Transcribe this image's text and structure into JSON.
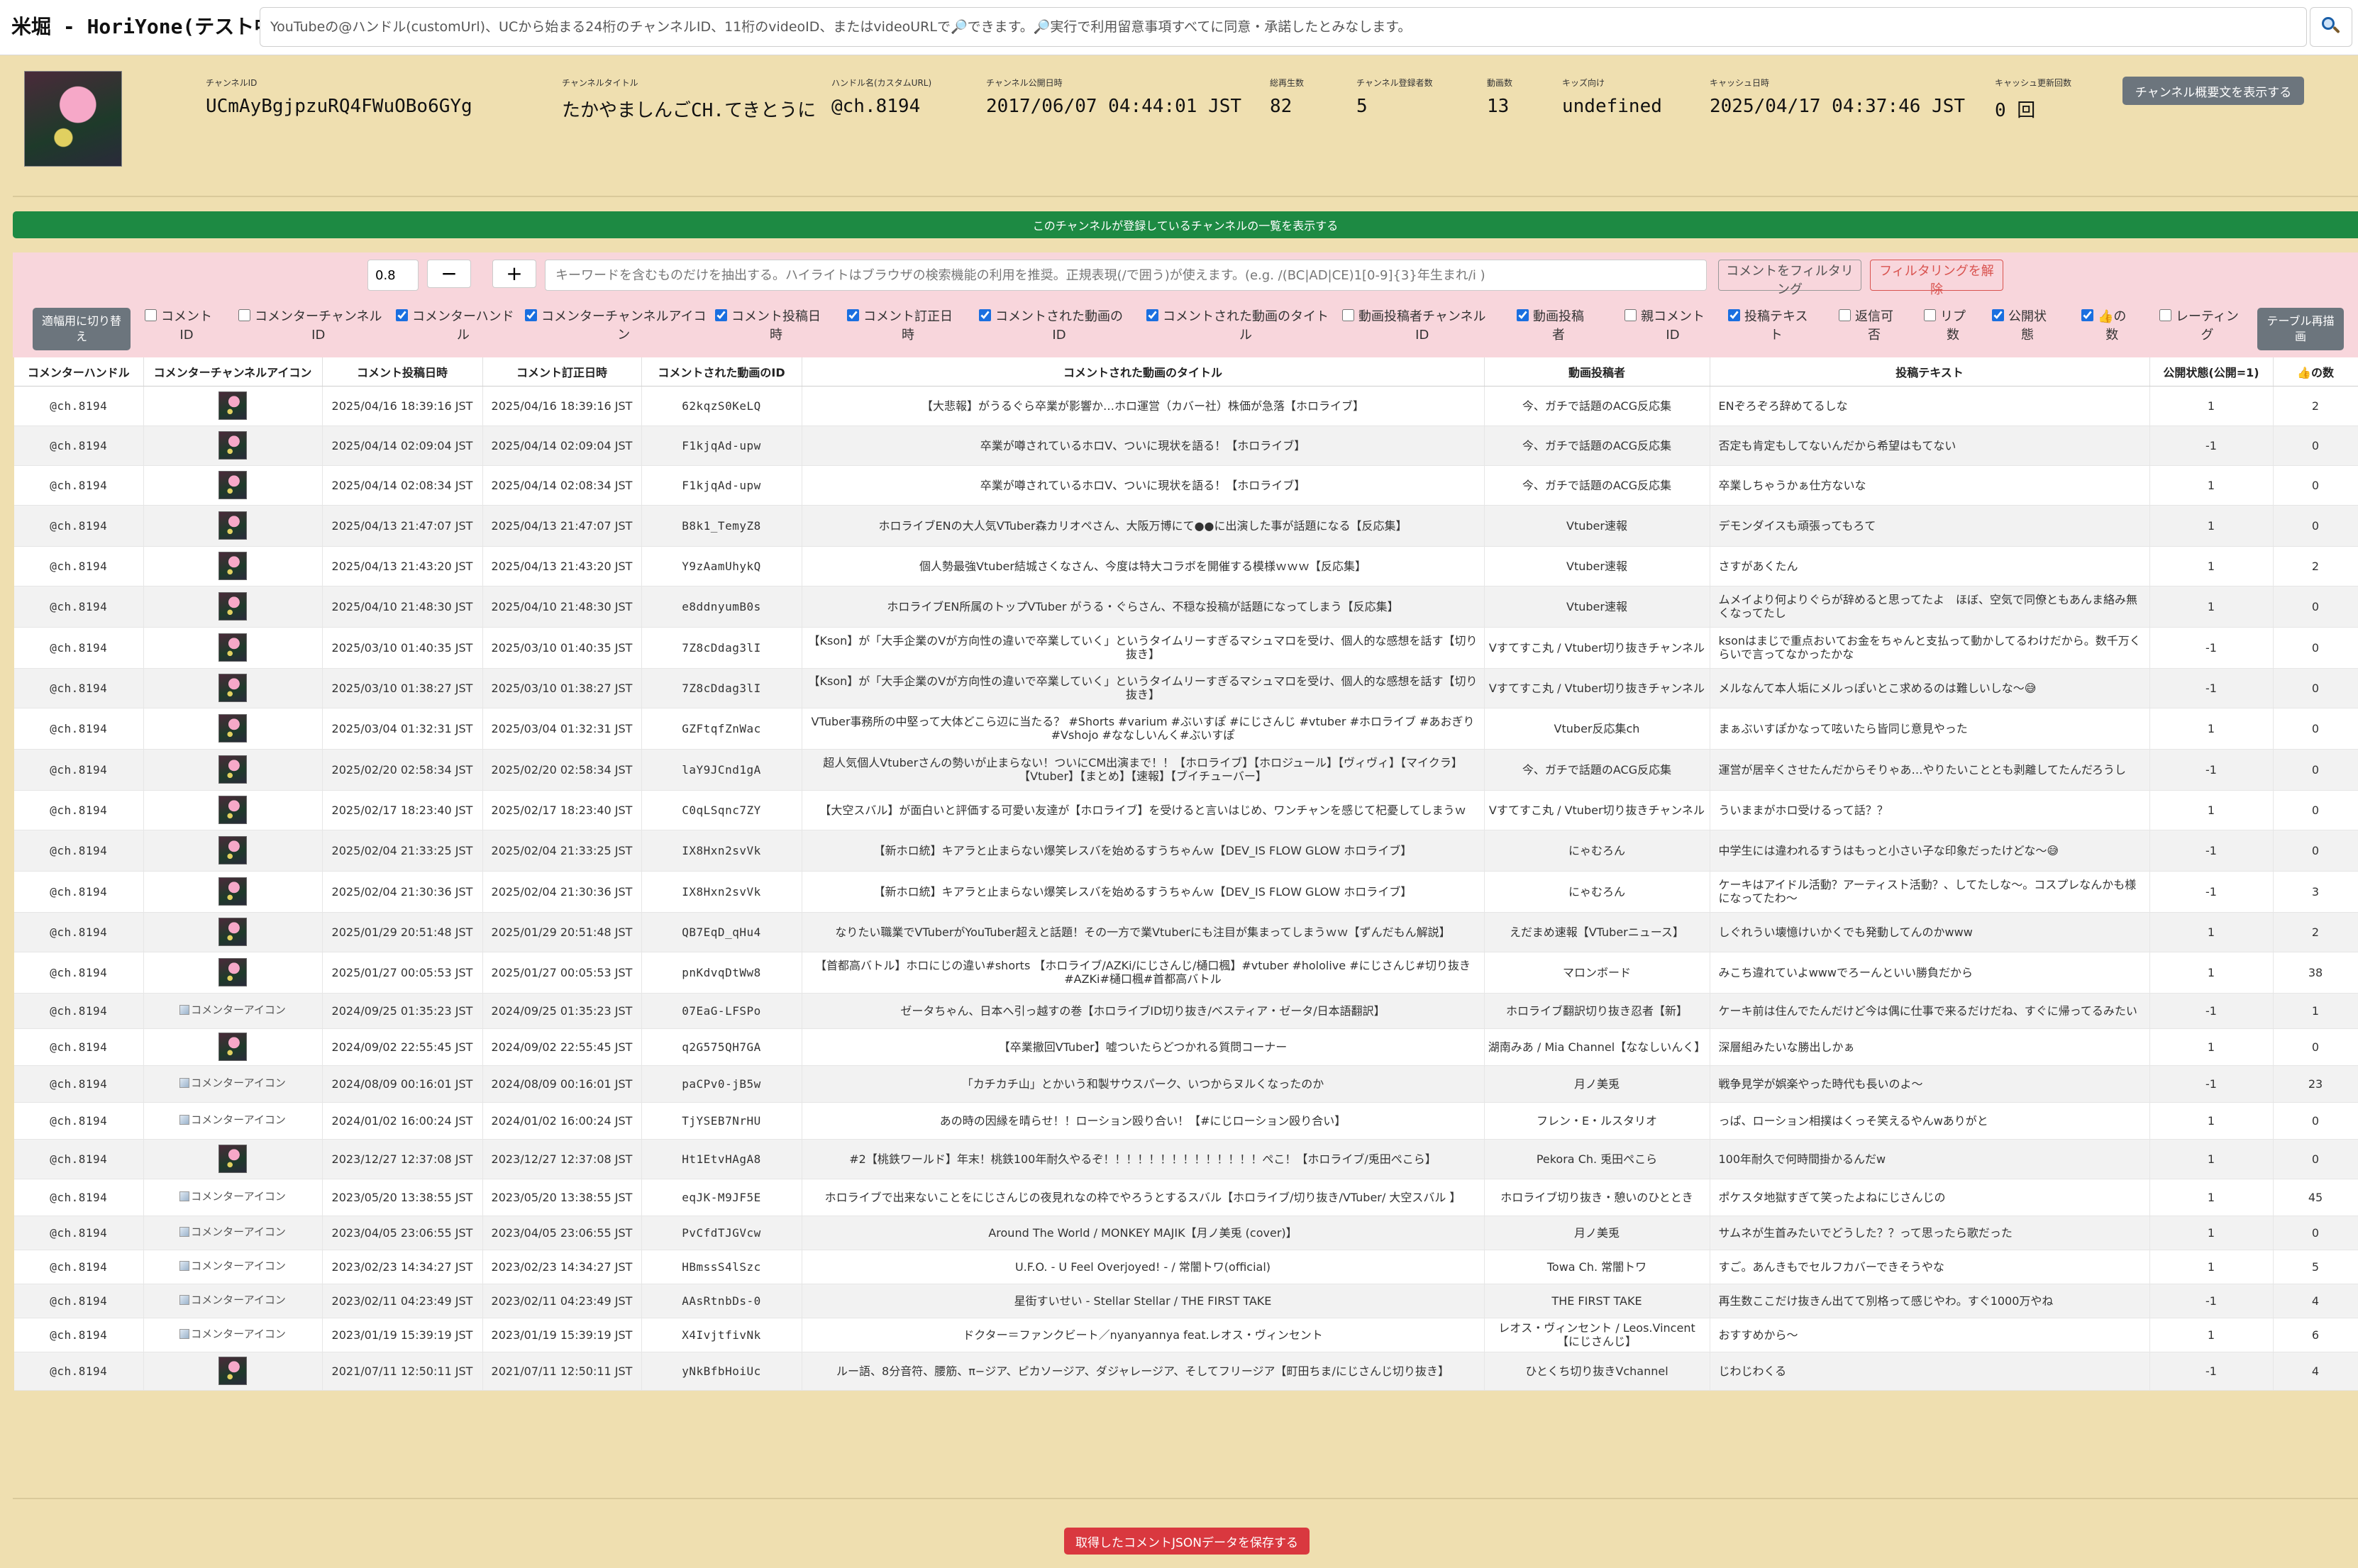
{
  "app": {
    "title": "米堀 - HoriYone(テスト中)"
  },
  "search": {
    "placeholder": "YouTubeの@ハンドル(customUrl)、UCから始まる24桁のチャンネルID、11桁のvideoID、またはvideoURLで🔎できます。🔎実行で利用留意事項すべてに同意・承諾したとみなします。",
    "button_icon": "magnifier-icon"
  },
  "channel": {
    "fields": [
      {
        "label": "チャンネルID",
        "value": "UCmAyBgjpzuRQ4FWuOBo6GYg"
      },
      {
        "label": "チャンネルタイトル",
        "value": "たかやましんごCH.てきとうに"
      },
      {
        "label": "ハンドル名(カスタムURL)",
        "value": "@ch.8194"
      },
      {
        "label": "チャンネル公開日時",
        "value": "2017/06/07 04:44:01 JST"
      },
      {
        "label": "総再生数",
        "value": "82"
      },
      {
        "label": "チャンネル登録者数",
        "value": "5"
      },
      {
        "label": "動画数",
        "value": "13"
      },
      {
        "label": "キッズ向け",
        "value": "undefined"
      },
      {
        "label": "キャッシュ日時",
        "value": "2025/04/17 04:37:46 JST"
      },
      {
        "label": "キャッシュ更新回数",
        "value": "0 回"
      }
    ],
    "show_description_label": "チャンネル概要文を表示する"
  },
  "subscriptions_button_label": "このチャンネルが登録しているチャンネルの一覧を表示する",
  "filter": {
    "number_value": "0.8",
    "minus_label": "−",
    "plus_label": "+",
    "keyword_placeholder": "キーワードを含むものだけを抽出する。ハイライトはブラウザの検索機能の利用を推奨。正規表現(/で囲う)が使えます。(e.g. /(BC|AD|CE)1[0-9]{3}年生まれ/i )",
    "filter_button": "コメントをフィルタリング",
    "unfilter_button": "フィルタリングを解除",
    "width_toggle": [
      "適幅用に切り替",
      "え"
    ],
    "redraw": [
      "テーブル再描",
      "画"
    ],
    "checkboxes": [
      {
        "lines": [
          "コメント",
          "ID"
        ],
        "checked": false
      },
      {
        "lines": [
          "コメンターチャンネル",
          "ID"
        ],
        "checked": false
      },
      {
        "lines": [
          "コメンターハンド",
          "ル"
        ],
        "checked": true
      },
      {
        "lines": [
          "コメンターチャンネルアイコ",
          "ン"
        ],
        "checked": true
      },
      {
        "lines": [
          "コメント投稿日",
          "時"
        ],
        "checked": true
      },
      {
        "lines": [
          "コメント訂正日",
          "時"
        ],
        "checked": true
      },
      {
        "lines": [
          "コメントされた動画の",
          "ID"
        ],
        "checked": true
      },
      {
        "lines": [
          "コメントされた動画のタイト",
          "ル"
        ],
        "checked": true
      },
      {
        "lines": [
          "動画投稿者チャンネル",
          "ID"
        ],
        "checked": false
      },
      {
        "lines": [
          "動画投稿",
          "者"
        ],
        "checked": true
      },
      {
        "lines": [
          "親コメント",
          "ID"
        ],
        "checked": false
      },
      {
        "lines": [
          "投稿テキス",
          "ト"
        ],
        "checked": true
      },
      {
        "lines": [
          "返信可",
          "否"
        ],
        "checked": false
      },
      {
        "lines": [
          "リプ",
          "数"
        ],
        "checked": false
      },
      {
        "lines": [
          "公開状",
          "態"
        ],
        "checked": true
      },
      {
        "lines": [
          "👍の",
          "数"
        ],
        "checked": true
      },
      {
        "lines": [
          "レーティン",
          "グ"
        ],
        "checked": false
      }
    ]
  },
  "table": {
    "headers": [
      "コメンターハンドル",
      "コメンターチャンネルアイコン",
      "コメント投稿日時",
      "コメント訂正日時",
      "コメントされた動画のID",
      "コメントされた動画のタイトル",
      "動画投稿者",
      "投稿テキスト",
      "公開状態(公開=1)",
      "👍の数"
    ],
    "rows": [
      {
        "handle": "@ch.8194",
        "icon": "avatar",
        "posted": "2025/04/16 18:39:16 JST",
        "edited": "2025/04/16 18:39:16 JST",
        "video_id": "62kqzS0KeLQ",
        "video_title": "【大悲報】がうるぐら卒業が影響か…ホロ運営（カバー社）株価が急落【ホロライブ】",
        "uploader": "今、ガチで話題のACG反応集",
        "text": "ENぞろぞろ辞めてるしな",
        "public": "1",
        "likes": "2"
      },
      {
        "handle": "@ch.8194",
        "icon": "avatar",
        "posted": "2025/04/14 02:09:04 JST",
        "edited": "2025/04/14 02:09:04 JST",
        "video_id": "F1kjqAd-upw",
        "video_title": "卒業が噂されているホロV、ついに現状を語る！【ホロライブ】",
        "uploader": "今、ガチで話題のACG反応集",
        "text": "否定も肯定もしてないんだから希望はもてない",
        "public": "-1",
        "likes": "0"
      },
      {
        "handle": "@ch.8194",
        "icon": "avatar",
        "posted": "2025/04/14 02:08:34 JST",
        "edited": "2025/04/14 02:08:34 JST",
        "video_id": "F1kjqAd-upw",
        "video_title": "卒業が噂されているホロV、ついに現状を語る！【ホロライブ】",
        "uploader": "今、ガチで話題のACG反応集",
        "text": "卒業しちゃうかぁ仕方ないな",
        "public": "1",
        "likes": "0"
      },
      {
        "handle": "@ch.8194",
        "icon": "avatar",
        "posted": "2025/04/13 21:47:07 JST",
        "edited": "2025/04/13 21:47:07 JST",
        "video_id": "B8k1_TemyZ8",
        "video_title": "ホロライブENの大人気VTuber森カリオペさん、大阪万博にて●●に出演した事が話題になる【反応集】",
        "uploader": "Vtuber速報",
        "text": "デモンダイスも頑張ってもろて",
        "public": "1",
        "likes": "0"
      },
      {
        "handle": "@ch.8194",
        "icon": "avatar",
        "posted": "2025/04/13 21:43:20 JST",
        "edited": "2025/04/13 21:43:20 JST",
        "video_id": "Y9zAamUhykQ",
        "video_title": "個人勢最強Vtuber結城さくなさん、今度は特大コラボを開催する模様ｗｗｗ【反応集】",
        "uploader": "Vtuber速報",
        "text": "さすがあくたん",
        "public": "1",
        "likes": "2"
      },
      {
        "handle": "@ch.8194",
        "icon": "avatar",
        "posted": "2025/04/10 21:48:30 JST",
        "edited": "2025/04/10 21:48:30 JST",
        "video_id": "e8ddnyumB0s",
        "video_title": "ホロライブEN所属のトップVTuber がうる・ぐらさん、不穏な投稿が話題になってしまう【反応集】",
        "uploader": "Vtuber速報",
        "text": "ムメイより何よりぐらが辞めると思ってたよ　ほぼ、空気で同僚ともあんま絡み無くなってたし",
        "public": "1",
        "likes": "0"
      },
      {
        "handle": "@ch.8194",
        "icon": "avatar",
        "posted": "2025/03/10 01:40:35 JST",
        "edited": "2025/03/10 01:40:35 JST",
        "video_id": "7Z8cDdag3lI",
        "video_title": "【Kson】が「大手企業のVが方向性の違いで卒業していく」というタイムリーすぎるマシュマロを受け、個人的な感想を話す【切り抜き】",
        "uploader": "Vすてすこ丸 / Vtuber切り抜きチャンネル",
        "text": "ksonはまじで重点おいてお金をちゃんと支払って動かしてるわけだから。数千万くらいで言ってなかったかな",
        "public": "-1",
        "likes": "0"
      },
      {
        "handle": "@ch.8194",
        "icon": "avatar",
        "posted": "2025/03/10 01:38:27 JST",
        "edited": "2025/03/10 01:38:27 JST",
        "video_id": "7Z8cDdag3lI",
        "video_title": "【Kson】が「大手企業のVが方向性の違いで卒業していく」というタイムリーすぎるマシュマロを受け、個人的な感想を話す【切り抜き】",
        "uploader": "Vすてすこ丸 / Vtuber切り抜きチャンネル",
        "text": "メルなんて本人垢にメルっぽいとこ求めるのは難しいしな〜😅",
        "public": "-1",
        "likes": "0"
      },
      {
        "handle": "@ch.8194",
        "icon": "avatar",
        "posted": "2025/03/04 01:32:31 JST",
        "edited": "2025/03/04 01:32:31 JST",
        "video_id": "GZFtqfZnWac",
        "video_title": "VTuber事務所の中堅って大体どこら辺に当たる？ #Shorts #varium #ぶいすぽ #にじさんじ #vtuber #ホロライブ #あおぎり #Vshojo #ななしいんく#ぶいすぽ",
        "uploader": "Vtuber反応集ch",
        "text": "まぁぶいすぽかなって呟いたら皆同じ意見やった",
        "public": "1",
        "likes": "0"
      },
      {
        "handle": "@ch.8194",
        "icon": "avatar",
        "posted": "2025/02/20 02:58:34 JST",
        "edited": "2025/02/20 02:58:34 JST",
        "video_id": "laY9JCnd1gA",
        "video_title": "超人気個人Vtuberさんの勢いが止まらない！ついにCM出演まで！！【ホロライブ】【ホロジュール】【ヴィヴィ】【マイクラ】【Vtuber】【まとめ】【速報】【ブイチューバー】",
        "uploader": "今、ガチで話題のACG反応集",
        "text": "運営が居辛くさせたんだからそりゃあ…やりたいこととも剥離してたんだろうし",
        "public": "-1",
        "likes": "0"
      },
      {
        "handle": "@ch.8194",
        "icon": "avatar",
        "posted": "2025/02/17 18:23:40 JST",
        "edited": "2025/02/17 18:23:40 JST",
        "video_id": "C0qLSqnc7ZY",
        "video_title": "【大空スバル】が面白いと評価する可愛い友達が【ホロライブ】を受けると言いはじめ、ワンチャンを感じて杞憂してしまうｗ",
        "uploader": "Vすてすこ丸 / Vtuber切り抜きチャンネル",
        "text": "ういままがホロ受けるって話？？",
        "public": "1",
        "likes": "0"
      },
      {
        "handle": "@ch.8194",
        "icon": "avatar",
        "posted": "2025/02/04 21:33:25 JST",
        "edited": "2025/02/04 21:33:25 JST",
        "video_id": "IX8Hxn2svVk",
        "video_title": "【新ホロ統】キアラと止まらない爆笑レスバを始めるすうちゃんｗ【DEV_IS FLOW GLOW ホロライブ】",
        "uploader": "にゃむろん",
        "text": "中学生には違われるすうはもっと小さい子な印象だったけどな〜😅",
        "public": "-1",
        "likes": "0"
      },
      {
        "handle": "@ch.8194",
        "icon": "avatar",
        "posted": "2025/02/04 21:30:36 JST",
        "edited": "2025/02/04 21:30:36 JST",
        "video_id": "IX8Hxn2svVk",
        "video_title": "【新ホロ統】キアラと止まらない爆笑レスバを始めるすうちゃんｗ【DEV_IS FLOW GLOW ホロライブ】",
        "uploader": "にゃむろん",
        "text": "ケーキはアイドル活動？アーティスト活動？、してたしな〜。コスプレなんかも様になってたわ〜",
        "public": "-1",
        "likes": "3"
      },
      {
        "handle": "@ch.8194",
        "icon": "avatar",
        "posted": "2025/01/29 20:51:48 JST",
        "edited": "2025/01/29 20:51:48 JST",
        "video_id": "QB7EqD_qHu4",
        "video_title": "なりたい職業でVTuberがYouTuber超えと話題！その一方で業Vtuberにも注目が集まってしまうｗｗ【ずんだもん解説】",
        "uploader": "えだまめ速報【VTuberニュース】",
        "text": "しぐれうい壊憶けいかくでも発動してんのかwww",
        "public": "1",
        "likes": "2"
      },
      {
        "handle": "@ch.8194",
        "icon": "avatar",
        "posted": "2025/01/27 00:05:53 JST",
        "edited": "2025/01/27 00:05:53 JST",
        "video_id": "pnKdvqDtWw8",
        "video_title": "【首都高バトル】ホロにじの違い#shorts 【ホロライブ/AZKi/にじさんじ/樋口楓】#vtuber #hololive #にじさんじ#切り抜き #AZKi#樋口楓#首都高バトル",
        "uploader": "マロンボード",
        "text": "みこち違れていよwwwでろーんといい勝負だから",
        "public": "1",
        "likes": "38"
      },
      {
        "handle": "@ch.8194",
        "icon": "broken",
        "posted": "2024/09/25 01:35:23 JST",
        "edited": "2024/09/25 01:35:23 JST",
        "video_id": "07EaG-LFSPo",
        "video_title": "ゼータちゃん、日本へ引っ越すの巻【ホロライブID切り抜き/ベスティア・ゼータ/日本語翻訳】",
        "uploader": "ホロライブ翻訳切り抜き忍者【新】",
        "text": "ケーキ前は住んでたんだけど今は偶に仕事で来るだけだね、すぐに帰ってるみたい",
        "public": "-1",
        "likes": "1"
      },
      {
        "handle": "@ch.8194",
        "icon": "avatar",
        "posted": "2024/09/02 22:55:45 JST",
        "edited": "2024/09/02 22:55:45 JST",
        "video_id": "q2G575QH7GA",
        "video_title": "【卒業撤回VTuber】嘘ついたらどつかれる質問コーナー",
        "uploader": "湖南みあ / Mia Channel【ななしいんく】",
        "text": "深層組みたいな勝出しかぁ",
        "public": "1",
        "likes": "0"
      },
      {
        "handle": "@ch.8194",
        "icon": "broken",
        "posted": "2024/08/09 00:16:01 JST",
        "edited": "2024/08/09 00:16:01 JST",
        "video_id": "paCPv0-jB5w",
        "video_title": "「カチカチ山」とかいう和製サウスパーク、いつからヌルくなったのか",
        "uploader": "月ノ美兎",
        "text": "戦争見学が娯楽やった時代も長いのよ〜",
        "public": "-1",
        "likes": "23"
      },
      {
        "handle": "@ch.8194",
        "icon": "broken",
        "posted": "2024/01/02 16:00:24 JST",
        "edited": "2024/01/02 16:00:24 JST",
        "video_id": "TjYSEB7NrHU",
        "video_title": "あの時の因縁を晴らせ！！ローション殴り合い！【#にじローション殴り合い】",
        "uploader": "フレン・E・ルスタリオ",
        "text": "っぱ、ローション相撲はくっそ笑えるやんwありがと",
        "public": "1",
        "likes": "0"
      },
      {
        "handle": "@ch.8194",
        "icon": "avatar",
        "posted": "2023/12/27 12:37:08 JST",
        "edited": "2023/12/27 12:37:08 JST",
        "video_id": "Ht1EtvHAgA8",
        "video_title": "#2【桃鉄ワールド】年末！桃鉄100年耐久やるぞ！！！！！！！！！！！！！！ぺこ！【ホロライブ/兎田ぺこら】",
        "uploader": "Pekora Ch. 兎田ぺこら",
        "text": "100年耐久で何時間掛かるんだw",
        "public": "1",
        "likes": "0"
      },
      {
        "handle": "@ch.8194",
        "icon": "broken",
        "posted": "2023/05/20 13:38:55 JST",
        "edited": "2023/05/20 13:38:55 JST",
        "video_id": "eqJK-M9JF5E",
        "video_title": "ホロライブで出来ないことをにじさんじの夜見れなの枠でやろうとするスバル【ホロライブ/切り抜き/VTuber/ 大空スバル 】",
        "uploader": "ホロライブ切り抜き・憩いのひととき",
        "text": "ポケスタ地獄すぎて笑ったよねにじさんじの",
        "public": "1",
        "likes": "45"
      },
      {
        "handle": "@ch.8194",
        "icon": "broken",
        "posted": "2023/04/05 23:06:55 JST",
        "edited": "2023/04/05 23:06:55 JST",
        "video_id": "PvCfdTJGVcw",
        "video_title": "Around The World / MONKEY MAJIK【月ノ美兎 (cover)】",
        "uploader": "月ノ美兎",
        "text": "サムネが生首みたいでどうした？？って思ったら歌だった",
        "public": "1",
        "likes": "0"
      },
      {
        "handle": "@ch.8194",
        "icon": "broken",
        "posted": "2023/02/23 14:34:27 JST",
        "edited": "2023/02/23 14:34:27 JST",
        "video_id": "HBmssS4lSzc",
        "video_title": "U.F.O. - U Feel Overjoyed! - / 常闇トワ(official)",
        "uploader": "Towa Ch. 常闇トワ",
        "text": "すご。あんきもでセルフカバーできそうやな",
        "public": "1",
        "likes": "5"
      },
      {
        "handle": "@ch.8194",
        "icon": "broken",
        "posted": "2023/02/11 04:23:49 JST",
        "edited": "2023/02/11 04:23:49 JST",
        "video_id": "AAsRtnbDs-0",
        "video_title": "星街すいせい - Stellar Stellar / THE FIRST TAKE",
        "uploader": "THE FIRST TAKE",
        "text": "再生数ここだけ抜きん出てて別格って感じやわ。すぐ1000万やね",
        "public": "-1",
        "likes": "4"
      },
      {
        "handle": "@ch.8194",
        "icon": "broken",
        "posted": "2023/01/19 15:39:19 JST",
        "edited": "2023/01/19 15:39:19 JST",
        "video_id": "X4IvjtfivNk",
        "video_title": "ドクター＝ファンクビート／nyanyannya feat.レオス・ヴィンセント",
        "uploader": "レオス・ヴィンセント / Leos.Vincent【にじさんじ】",
        "text": "おすすめから〜",
        "public": "1",
        "likes": "6"
      },
      {
        "handle": "@ch.8194",
        "icon": "avatar",
        "posted": "2021/07/11 12:50:11 JST",
        "edited": "2021/07/11 12:50:11 JST",
        "video_id": "yNkBfbHoiUc",
        "video_title": "ルー語、8分音符、腰筋、π−ジア、ピカソージア、ダジャレージア、そしてフリージア【町田ちま/にじさんじ切り抜き】",
        "uploader": "ひとくち切り抜きVchannel",
        "text": "じわじわくる",
        "public": "-1",
        "likes": "4"
      }
    ],
    "broken_icon_alt": "コメンターアイコン"
  },
  "save_button_label": "取得したコメントJSONデータを保存する",
  "colors": {
    "background": "#efdfb0",
    "filter_panel": "#f8d6dc",
    "green_bar": "#1d8a43",
    "dark_button": "#6c757d",
    "save_button": "#d9383f",
    "unfilter_red": "#d9534f"
  }
}
